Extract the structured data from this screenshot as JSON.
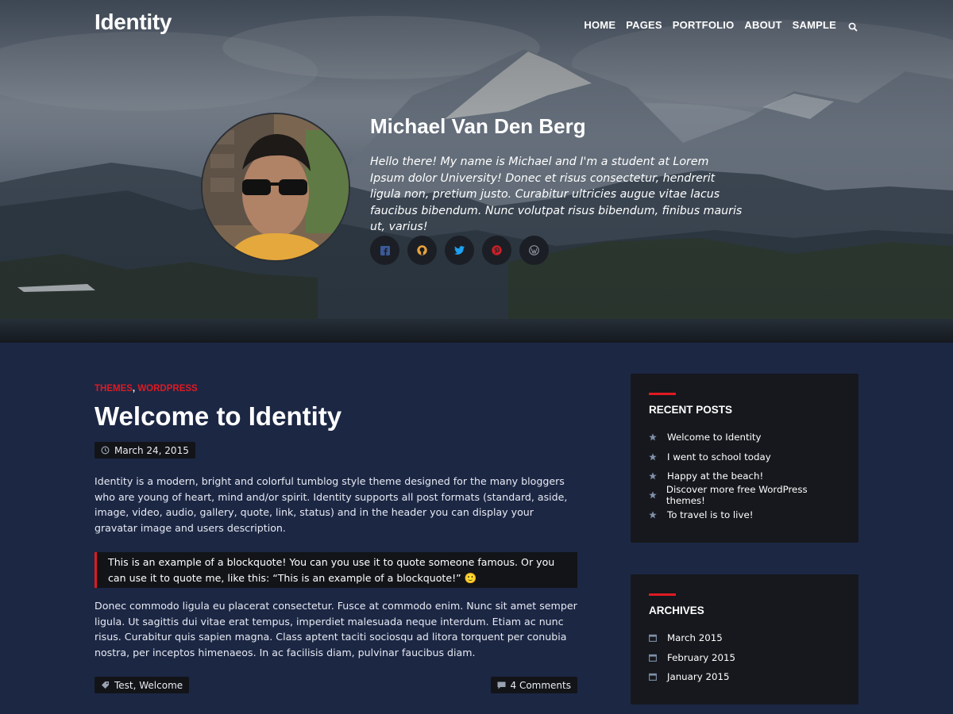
{
  "site": {
    "title": "Identity"
  },
  "nav": {
    "items": [
      "HOME",
      "PAGES",
      "PORTFOLIO",
      "ABOUT",
      "SAMPLE"
    ],
    "search_icon": "search-icon"
  },
  "profile": {
    "name": "Michael Van Den Berg",
    "bio": "Hello there! My name is Michael and I'm a student at Lorem Ipsum dolor University! Donec et risus consectetur, hendrerit ligula non, pretium justo. Curabitur ultricies augue vitae lacus faucibus bibendum. Nunc volutpat risus bibendum, finibus mauris ut, varius!",
    "socials": [
      {
        "icon": "facebook-icon",
        "color": "#3b5998"
      },
      {
        "icon": "github-icon",
        "color": "#e8a33c"
      },
      {
        "icon": "twitter-icon",
        "color": "#1da1f2"
      },
      {
        "icon": "pinterest-icon",
        "color": "#cb2027"
      },
      {
        "icon": "wordpress-icon",
        "color": "#8a8f99"
      }
    ]
  },
  "post": {
    "categories": [
      "THEMES",
      "WORDPRESS"
    ],
    "title": "Welcome to Identity",
    "date": "March 24, 2015",
    "intro": "Identity is a modern, bright and colorful tumblog style theme designed for the many bloggers who are young of heart, mind and/or spirit. Identity supports all post formats (standard, aside, image, video, audio, gallery, quote, link, status) and in the header you can display your gravatar image and users description.",
    "quote": "This is an example of a blockquote! You can you use it to quote someone famous. Or you can use it to quote me, like this: “This is an example of a blockquote!” 🙂",
    "body": "Donec commodo ligula eu placerat consectetur. Fusce at commodo enim. Nunc sit amet semper ligula. Ut sagittis dui vitae erat tempus, imperdiet malesuada neque interdum. Etiam ac nunc risus. Curabitur quis sapien magna. Class aptent taciti sociosqu ad litora torquent per conubia nostra, per inceptos himenaeos. In ac facilisis diam, pulvinar faucibus diam.",
    "tags": "Test, Welcome",
    "comments": "4 Comments"
  },
  "sidebar": {
    "recent": {
      "title": "RECENT POSTS",
      "items": [
        "Welcome to Identity",
        "I went to school today",
        "Happy at the beach!",
        "Discover more free WordPress themes!",
        "To travel is to live!"
      ]
    },
    "archives": {
      "title": "ARCHIVES",
      "items": [
        "March 2015",
        "February 2015",
        "January 2015"
      ]
    }
  },
  "colors": {
    "accent": "#e01a22",
    "page_bg": "#1c2744",
    "widget_bg": "#16181d"
  }
}
